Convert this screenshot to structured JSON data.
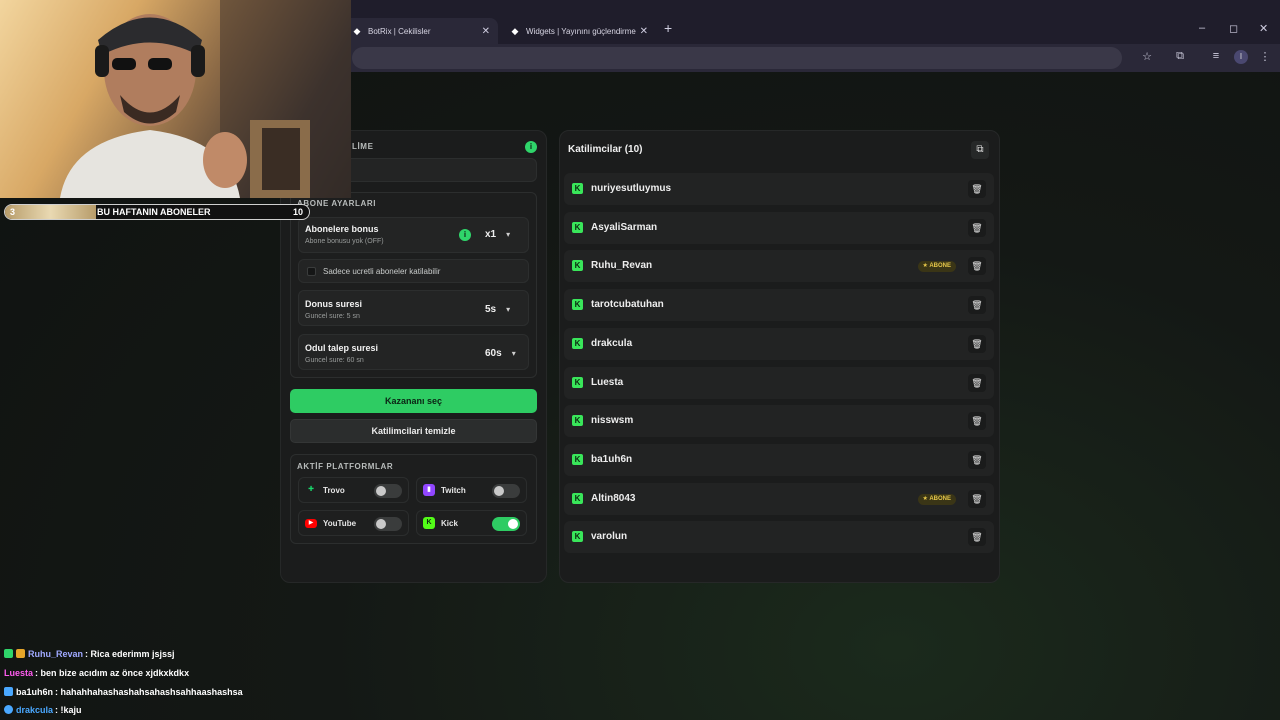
{
  "browser": {
    "tabs": [
      {
        "label": "BotRix | Cekilisler",
        "icon": "botrix-icon"
      },
      {
        "label": "Widgets | Yayınını güçlendirme",
        "icon": "botrix-icon"
      }
    ],
    "new_tab": "+",
    "window_controls": [
      "–",
      "◻",
      "✕"
    ],
    "profile_initial": "I"
  },
  "webcam": {
    "subscriber_goal": {
      "current": "3",
      "label": "BU HAFTANIN ABONELER",
      "target": "10",
      "progress": 0.3
    }
  },
  "left_panel": {
    "header_partial": "LİME",
    "sub_settings_title": "ABONE AYARLARI",
    "bonus": {
      "label": "Abonelere bonus",
      "sub": "Abone bonusu yok (OFF)",
      "value": "x1"
    },
    "paid_only": {
      "label": "Sadece ucretli aboneler katilabilir"
    },
    "bonus_time": {
      "label": "Donus suresi",
      "sub": "Guncel sure: 5 sn",
      "value": "5s"
    },
    "claim_time": {
      "label": "Odul talep suresi",
      "sub": "Guncel sure: 60 sn",
      "value": "60s"
    },
    "pick_winner": "Kazananı seç",
    "clear_participants": "Katilimcilari temizle",
    "platforms_title": "AKTİF PLATFORMLAR",
    "platforms": [
      {
        "name": "Trovo",
        "enabled": false,
        "color": "#19d66b"
      },
      {
        "name": "Twitch",
        "enabled": false,
        "color": "#9146ff"
      },
      {
        "name": "YouTube",
        "enabled": false,
        "color": "#ff0000"
      },
      {
        "name": "Kick",
        "enabled": true,
        "color": "#53fc18"
      }
    ]
  },
  "right_panel": {
    "title": "Katilimcilar (10)",
    "abone_badge": "ABONE",
    "participants": [
      {
        "name": "nuriyesutluymus",
        "abone": false
      },
      {
        "name": "AsyaliSarman",
        "abone": false
      },
      {
        "name": "Ruhu_Revan",
        "abone": true
      },
      {
        "name": "tarotcubatuhan",
        "abone": false
      },
      {
        "name": "drakcula",
        "abone": false
      },
      {
        "name": "Luesta",
        "abone": false
      },
      {
        "name": "nisswsm",
        "abone": false
      },
      {
        "name": "ba1uh6n",
        "abone": false
      },
      {
        "name": "Altin8043",
        "abone": true
      },
      {
        "name": "varolun",
        "abone": false
      }
    ]
  },
  "chat": [
    {
      "user": "Ruhu_Revan",
      "message": ": Rica ederimm jsjssj",
      "color": "#9fa9ff"
    },
    {
      "user": "Luesta",
      "message": ": ben bize acıdım az önce xjdkxkdkx",
      "color": "#ff5cf0"
    },
    {
      "user": "ba1uh6n",
      "message": ": hahahhahashashahsahashsahhaashashsa",
      "color": "#ffffff"
    },
    {
      "user": "drakcula",
      "message": ": !kaju",
      "color": "#4aa8ff"
    }
  ]
}
